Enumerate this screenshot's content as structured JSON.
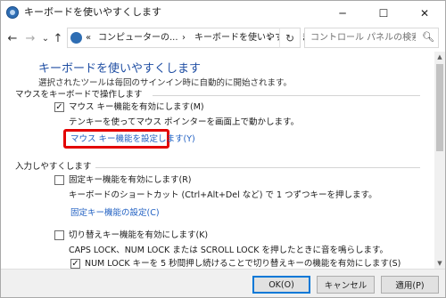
{
  "window": {
    "title": "キーボードを使いやすくします",
    "controls": {
      "minimize": "─",
      "maximize": "☐",
      "close": "✕"
    }
  },
  "nav": {
    "back": "←",
    "forward": "→",
    "recent": "⌄",
    "up": "↑",
    "address_chevron": "«",
    "address_segments": [
      "コンピューターの...",
      "キーボードを使いやすくします"
    ],
    "address_separator": "›",
    "address_dropdown": "⌄",
    "refresh": "↻",
    "search_placeholder": "コントロール パネルの検索",
    "search_icon": "search-icon"
  },
  "content": {
    "heading": "キーボードを使いやすくします",
    "subtitle": "選択されたツールは毎回のサインイン時に自動的に開始されます。",
    "section_mouse": {
      "header": "マウスをキーボードで操作します",
      "checkbox_label": "マウス キー機能を有効にします(M)",
      "checked": true,
      "description": "テンキーを使ってマウス ポインターを画面上で動かします。",
      "link": "マウス キー機能を設定します(Y)"
    },
    "section_input": {
      "header": "入力しやすくします",
      "sticky_label": "固定キー機能を有効にします(R)",
      "sticky_checked": false,
      "sticky_description": "キーボードのショートカット (Ctrl+Alt+Del など) で 1 つずつキーを押します。",
      "sticky_link": "固定キー機能の設定(C)",
      "toggle_label": "切り替えキー機能を有効にします(K)",
      "toggle_checked": false,
      "toggle_description": "CAPS LOCK、NUM LOCK または SCROLL LOCK を押したときに音を鳴らします。",
      "numlock_label": "NUM LOCK キーを 5 秒間押し続けることで切り替えキーの機能を有効にします(S)",
      "numlock_checked": true
    }
  },
  "footer": {
    "ok": "OK(O)",
    "cancel": "キャンセル",
    "apply": "適用(P)"
  },
  "colors": {
    "heading": "#1f4ea3",
    "link": "#1f5fc2",
    "highlight": "#e30000",
    "primary_border": "#0078d7"
  }
}
